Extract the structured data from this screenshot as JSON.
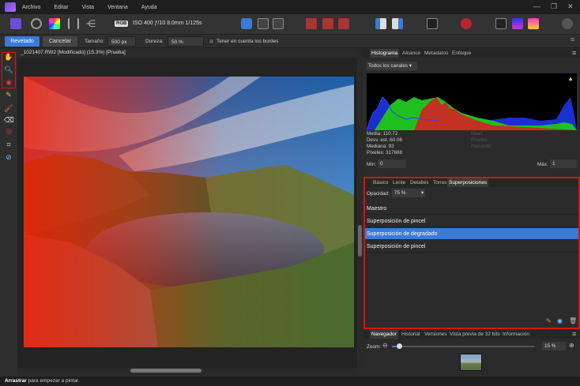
{
  "menu": {
    "items": [
      "Archivo",
      "Editar",
      "Vista",
      "Ventana",
      "Ayuda"
    ]
  },
  "toolbar": {
    "color_format": "RGB",
    "exif": "ISO 400 ƒ/10 8.0mm 1/125s"
  },
  "contextbar": {
    "revelado_label": "Revelado",
    "cancelar_label": "Cancelar",
    "tamano_label": "Tamaño:",
    "tamano_value": "500 px",
    "dureza_label": "Dureza:",
    "dureza_value": "50 %",
    "bordes_label": "Tener en cuenta los bordes"
  },
  "document": {
    "title": "_1021407.RW2 [Modificado] (15.3%) [Prueba]"
  },
  "status": {
    "bold": "Arrastrar",
    "text": " para empezar a pintar."
  },
  "histogram_panel": {
    "tabs": [
      "Histograma",
      "Alcance",
      "Metadatos",
      "Enfoque"
    ],
    "channel_select": "Todos los canales",
    "stats_left": [
      "Media: 110.72",
      "Desv. est.:60.06",
      "Mediana: 93",
      "Píxeles: 317688"
    ],
    "stats_right": [
      "Nivel:",
      "Píxeles:",
      "Percentil:"
    ],
    "min_label": "Mín:",
    "min_value": "0",
    "max_label": "Máx:",
    "max_value": "1"
  },
  "adjust_panel": {
    "tabs": [
      "Básico",
      "Lente",
      "Detalles",
      "Tonos",
      "Superposiciones"
    ],
    "opacity_label": "Opacidad:",
    "opacity_value": "75 %",
    "layers": [
      "Maestro",
      "Superposición de pincel",
      "Superposición de degradado",
      "Superposición de pincel"
    ],
    "selected_index": 2
  },
  "navigator_panel": {
    "tabs": [
      "Navegador",
      "Historial",
      "Versiones",
      "Vista previa de 32 bits",
      "Información"
    ],
    "zoom_label": "Zoom:",
    "zoom_value": "15 %",
    "zoom_slider": 0.05
  },
  "colors": {
    "accent": "#3a7bd5",
    "highlight": "#dd1111"
  }
}
